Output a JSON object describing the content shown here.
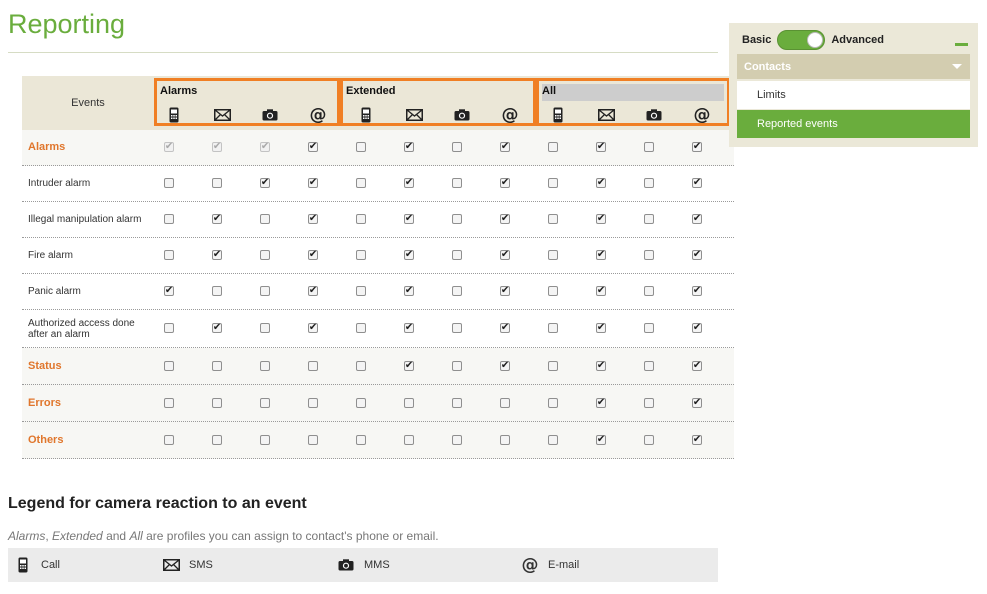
{
  "page": {
    "title": "Reporting"
  },
  "table": {
    "events_header": "Events",
    "groups": [
      {
        "name": "Alarms",
        "icons": [
          "phone-icon",
          "envelope-icon",
          "camera-icon",
          "at-icon"
        ]
      },
      {
        "name": "Extended",
        "icons": [
          "phone-icon",
          "envelope-icon",
          "camera-icon",
          "at-icon"
        ]
      },
      {
        "name": "All",
        "icons": [
          "phone-icon",
          "envelope-icon",
          "camera-icon",
          "at-icon"
        ]
      }
    ],
    "rows": [
      {
        "label": "Alarms",
        "category": true,
        "checks": [
          1,
          1,
          1,
          1,
          0,
          1,
          0,
          1,
          0,
          1,
          0,
          1
        ],
        "disabled": [
          1,
          1,
          1,
          0,
          0,
          0,
          0,
          0,
          0,
          0,
          0,
          0
        ]
      },
      {
        "label": "Intruder alarm",
        "category": false,
        "checks": [
          0,
          0,
          1,
          1,
          0,
          1,
          0,
          1,
          0,
          1,
          0,
          1
        ],
        "disabled": [
          0,
          0,
          0,
          0,
          0,
          0,
          0,
          0,
          0,
          0,
          0,
          0
        ]
      },
      {
        "label": "Illegal manipulation alarm",
        "category": false,
        "checks": [
          0,
          1,
          0,
          1,
          0,
          1,
          0,
          1,
          0,
          1,
          0,
          1
        ],
        "disabled": [
          0,
          0,
          0,
          0,
          0,
          0,
          0,
          0,
          0,
          0,
          0,
          0
        ]
      },
      {
        "label": "Fire alarm",
        "category": false,
        "checks": [
          0,
          1,
          0,
          1,
          0,
          1,
          0,
          1,
          0,
          1,
          0,
          1
        ],
        "disabled": [
          0,
          0,
          0,
          0,
          0,
          0,
          0,
          0,
          0,
          0,
          0,
          0
        ]
      },
      {
        "label": "Panic alarm",
        "category": false,
        "checks": [
          1,
          0,
          0,
          1,
          0,
          1,
          0,
          1,
          0,
          1,
          0,
          1
        ],
        "disabled": [
          0,
          0,
          0,
          0,
          0,
          0,
          0,
          0,
          0,
          0,
          0,
          0
        ]
      },
      {
        "label": "Authorized access done after an alarm",
        "category": false,
        "checks": [
          0,
          1,
          0,
          1,
          0,
          1,
          0,
          1,
          0,
          1,
          0,
          1
        ],
        "disabled": [
          0,
          0,
          0,
          0,
          0,
          0,
          0,
          0,
          0,
          0,
          0,
          0
        ]
      },
      {
        "label": "Status",
        "category": true,
        "checks": [
          0,
          0,
          0,
          0,
          0,
          1,
          0,
          1,
          0,
          1,
          0,
          1
        ],
        "disabled": [
          0,
          0,
          0,
          0,
          0,
          0,
          0,
          0,
          0,
          0,
          0,
          0
        ]
      },
      {
        "label": "Errors",
        "category": true,
        "checks": [
          0,
          0,
          0,
          0,
          0,
          0,
          0,
          0,
          0,
          1,
          0,
          1
        ],
        "disabled": [
          0,
          0,
          0,
          0,
          0,
          0,
          0,
          0,
          0,
          0,
          0,
          0
        ]
      },
      {
        "label": "Others",
        "category": true,
        "checks": [
          0,
          0,
          0,
          0,
          0,
          0,
          0,
          0,
          0,
          1,
          0,
          1
        ],
        "disabled": [
          0,
          0,
          0,
          0,
          0,
          0,
          0,
          0,
          0,
          0,
          0,
          0
        ]
      }
    ]
  },
  "legend": {
    "title": "Legend for camera reaction to an event",
    "desc_alarms": "Alarms",
    "desc_sep1": ", ",
    "desc_extended": "Extended",
    "desc_and": " and ",
    "desc_all": "All",
    "desc_rest": " are profiles you can assign to contact's phone or email.",
    "items": [
      {
        "icon": "phone-icon",
        "label": "Call"
      },
      {
        "icon": "envelope-icon",
        "label": "SMS"
      },
      {
        "icon": "camera-icon",
        "label": "MMS"
      },
      {
        "icon": "at-icon",
        "label": "E-mail"
      }
    ]
  },
  "side_panel": {
    "mode_basic": "Basic",
    "mode_advanced": "Advanced",
    "mode_selected": "Advanced",
    "menu_header": "Contacts",
    "items": [
      {
        "label": "Limits",
        "active": false
      },
      {
        "label": "Reported events",
        "active": true
      }
    ]
  },
  "colors": {
    "accent_green": "#6aad3d",
    "highlight_orange": "#f07f24",
    "category_orange": "#e0762c"
  }
}
